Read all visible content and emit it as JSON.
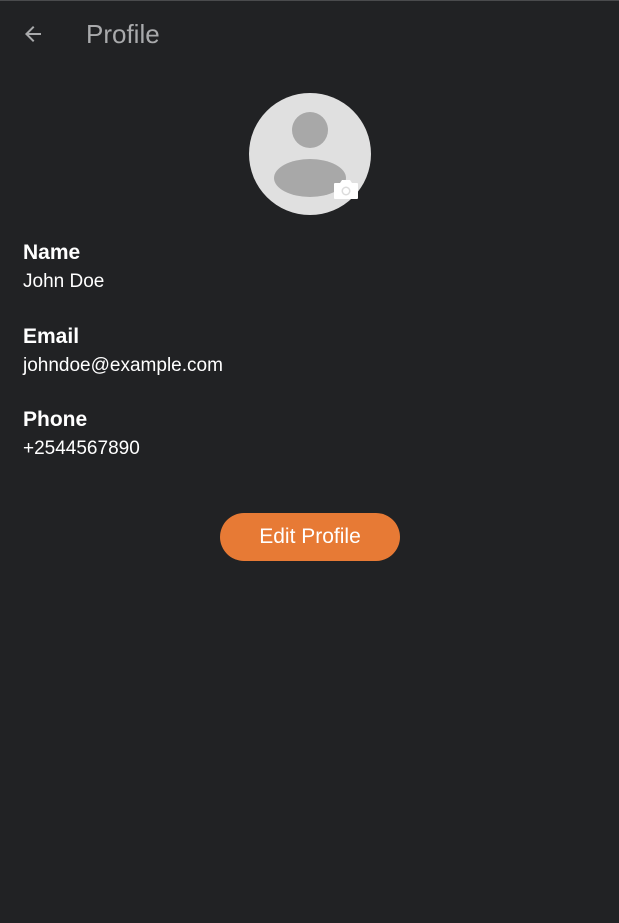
{
  "app_bar": {
    "back_icon": "arrow-left-icon",
    "title": "Profile"
  },
  "avatar": {
    "icon": "person-icon",
    "camera_icon": "camera-icon"
  },
  "fields": [
    {
      "label": "Name",
      "value": "John Doe"
    },
    {
      "label": "Email",
      "value": "johndoe@example.com"
    },
    {
      "label": "Phone",
      "value": "+2544567890"
    }
  ],
  "actions": {
    "edit_label": "Edit Profile"
  },
  "colors": {
    "background": "#212224",
    "title_text": "#a9aaac",
    "accent": "#e77a35",
    "avatar_bg": "#e0e0e0",
    "avatar_figure": "#a8a8a8"
  }
}
